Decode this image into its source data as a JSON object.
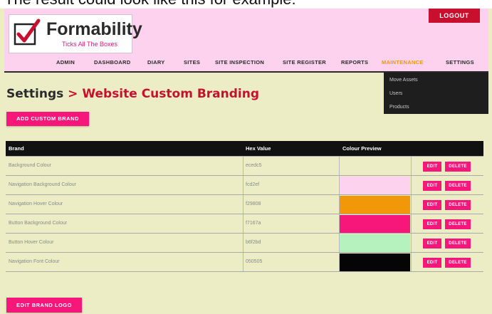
{
  "caption": "The result could look like this for example:",
  "logo": {
    "name": "Formability",
    "tagline": "Ticks All The Boxes"
  },
  "header": {
    "logout_label": "LOGOUT"
  },
  "nav": {
    "items": [
      {
        "label": "ADMIN",
        "active": false
      },
      {
        "label": "DASHBOARD",
        "active": false
      },
      {
        "label": "DIARY",
        "active": false
      },
      {
        "label": "SITES",
        "active": false
      },
      {
        "label": "SITE INSPECTION",
        "active": false
      },
      {
        "label": "SITE REGISTER",
        "active": false
      },
      {
        "label": "REPORTS",
        "active": false
      },
      {
        "label": "MAINTENANCE",
        "active": true
      },
      {
        "label": "SETTINGS",
        "active": false
      }
    ]
  },
  "dropdown": {
    "items": [
      "Move Assets",
      "Users",
      "Products"
    ]
  },
  "page": {
    "title_settings": "Settings",
    "title_arrow": ">",
    "title_page": "Website Custom Branding",
    "add_button": "ADD CUSTOM BRAND",
    "edit_logo_button": "EDIT BRAND LOGO"
  },
  "table": {
    "headers": [
      "Brand",
      "Hex Value",
      "Colour Preview"
    ],
    "edit_label": "EDIT",
    "delete_label": "DELETE",
    "rows": [
      {
        "brand": "Background Colour",
        "hex": "ecedc5",
        "swatch": "#ecedc5"
      },
      {
        "brand": "Navigation Background Colour",
        "hex": "fcd2ef",
        "swatch": "#fcd2ef"
      },
      {
        "brand": "Navigation Hover Colour",
        "hex": "f29808",
        "swatch": "#f29808"
      },
      {
        "brand": "Button Background Colour",
        "hex": "f7167a",
        "swatch": "#f7167a"
      },
      {
        "brand": "Button Hover Colour",
        "hex": "b6f2bd",
        "swatch": "#b6f2bd"
      },
      {
        "brand": "Navigation Font Colour",
        "hex": "050505",
        "swatch": "#050505"
      }
    ]
  },
  "colors": {
    "accent": "#f7167a",
    "title_red": "#c8102e",
    "logout_red": "#c8102e",
    "nav_active": "#f29808"
  }
}
